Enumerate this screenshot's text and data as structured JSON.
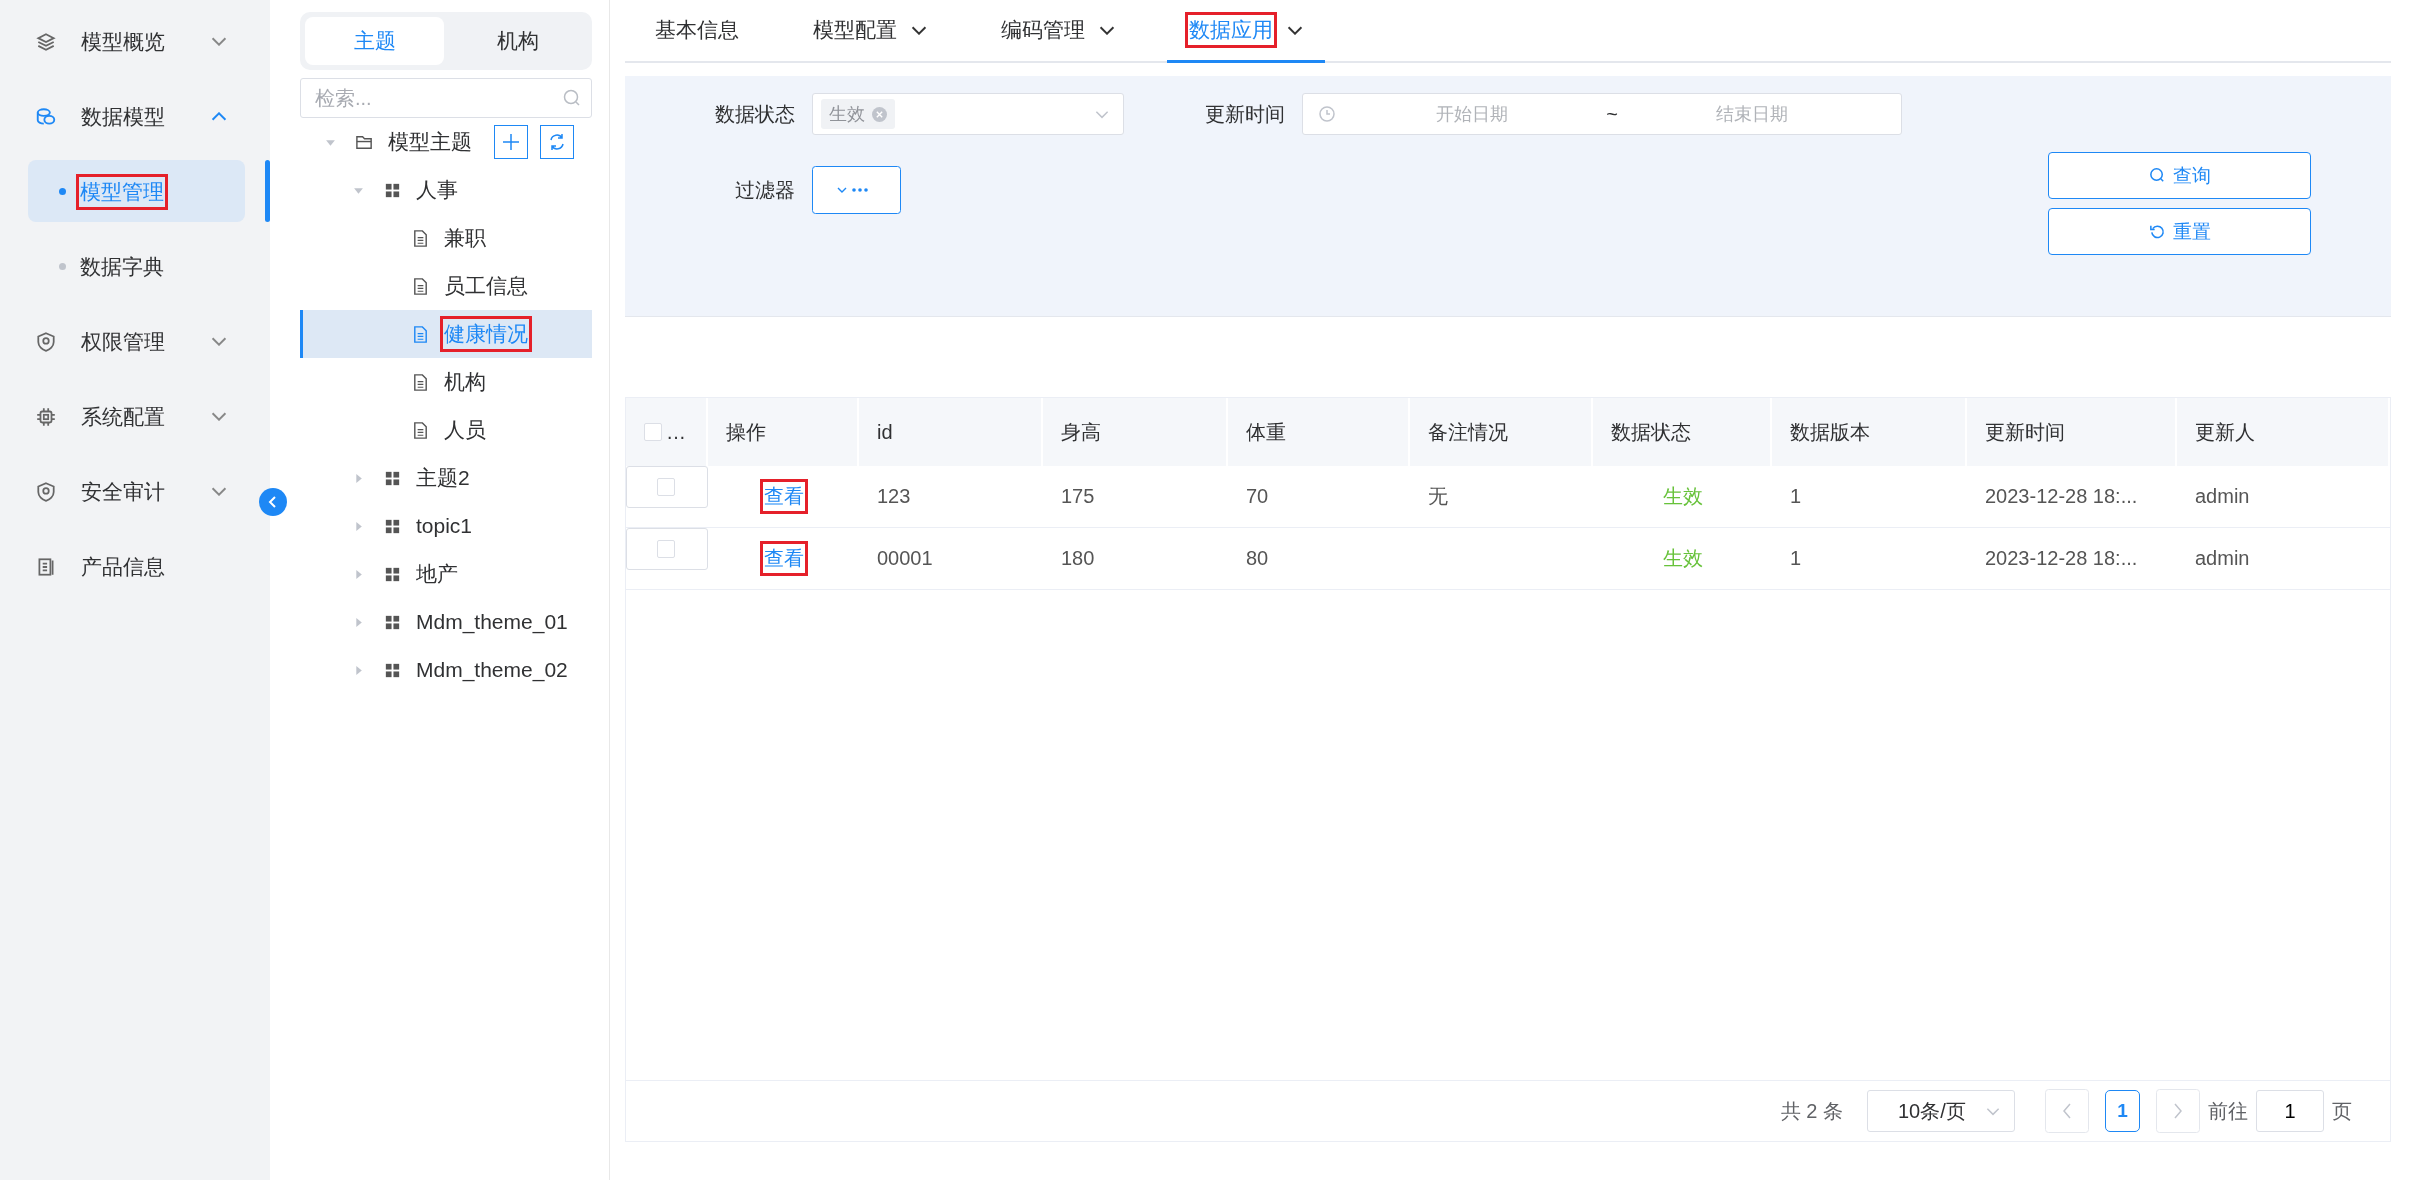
{
  "sidebar": {
    "items": [
      {
        "label": "模型概览",
        "kind": "group",
        "expanded": false
      },
      {
        "label": "数据模型",
        "kind": "group",
        "expanded": true,
        "children": [
          {
            "label": "模型管理",
            "selected": true,
            "highlighted": true
          },
          {
            "label": "数据字典",
            "selected": false,
            "highlighted": false
          }
        ]
      },
      {
        "label": "权限管理",
        "kind": "group",
        "expanded": false
      },
      {
        "label": "系统配置",
        "kind": "group",
        "expanded": false
      },
      {
        "label": "安全审计",
        "kind": "group",
        "expanded": false
      },
      {
        "label": "产品信息",
        "kind": "link"
      }
    ]
  },
  "tree_panel": {
    "tabs": [
      {
        "label": "主题",
        "selected": true
      },
      {
        "label": "机构",
        "selected": false
      }
    ],
    "search": {
      "placeholder": "检索..."
    },
    "nodes": [
      {
        "label": "模型主题",
        "kind": "folder",
        "expanded": true,
        "selected": false,
        "highlighted": false,
        "children": [
          {
            "label": "人事",
            "kind": "group",
            "expanded": true,
            "selected": false,
            "highlighted": false,
            "children": [
              {
                "label": "兼职",
                "kind": "doc",
                "selected": false,
                "highlighted": false
              },
              {
                "label": "员工信息",
                "kind": "doc",
                "selected": false,
                "highlighted": false
              },
              {
                "label": "健康情况",
                "kind": "doc",
                "selected": true,
                "highlighted": true
              },
              {
                "label": "机构",
                "kind": "doc",
                "selected": false,
                "highlighted": false
              },
              {
                "label": "人员",
                "kind": "doc",
                "selected": false,
                "highlighted": false
              }
            ]
          },
          {
            "label": "主题2",
            "kind": "group",
            "expanded": false,
            "selected": false,
            "highlighted": false
          },
          {
            "label": "topic1",
            "kind": "group",
            "expanded": false,
            "selected": false,
            "highlighted": false
          },
          {
            "label": "地产",
            "kind": "group",
            "expanded": false,
            "selected": false,
            "highlighted": false
          },
          {
            "label": "Mdm_theme_01",
            "kind": "group",
            "expanded": false,
            "selected": false,
            "highlighted": false
          },
          {
            "label": "Mdm_theme_02",
            "kind": "group",
            "expanded": false,
            "selected": false,
            "highlighted": false
          }
        ]
      }
    ]
  },
  "tabs": [
    {
      "label": "基本信息",
      "dropdown": false,
      "selected": false,
      "highlighted": false
    },
    {
      "label": "模型配置",
      "dropdown": true,
      "selected": false,
      "highlighted": false
    },
    {
      "label": "编码管理",
      "dropdown": true,
      "selected": false,
      "highlighted": false
    },
    {
      "label": "数据应用",
      "dropdown": true,
      "selected": true,
      "highlighted": true
    }
  ],
  "filters": {
    "status_label": "数据状态",
    "status_tags": [
      "生效"
    ],
    "time_label": "更新时间",
    "start_placeholder": "开始日期",
    "range_separator": "~",
    "end_placeholder": "结束日期",
    "filter_label": "过滤器",
    "query_button": "查询",
    "reset_button": "重置"
  },
  "table": {
    "header_checked": false,
    "columns": [
      {
        "label": "…",
        "kind": "select"
      },
      {
        "label": "操作",
        "kind": "action"
      },
      {
        "label": "id",
        "kind": "text"
      },
      {
        "label": "身高",
        "kind": "text"
      },
      {
        "label": "体重",
        "kind": "text"
      },
      {
        "label": "备注情况",
        "kind": "text"
      },
      {
        "label": "数据状态",
        "kind": "status"
      },
      {
        "label": "数据版本",
        "kind": "text"
      },
      {
        "label": "更新时间",
        "kind": "text"
      },
      {
        "label": "更新人",
        "kind": "text"
      }
    ],
    "rows": [
      {
        "checked": false,
        "action_highlighted": true,
        "cells": [
          "",
          "查看",
          "123",
          "175",
          "70",
          "无",
          "生效",
          "1",
          "2023-12-28 18:...",
          "admin"
        ]
      },
      {
        "checked": false,
        "action_highlighted": true,
        "cells": [
          "",
          "查看",
          "00001",
          "180",
          "80",
          "",
          "生效",
          "1",
          "2023-12-28 18:...",
          "admin"
        ]
      }
    ]
  },
  "pagination": {
    "total": "共 2 条",
    "page_size": "10条/页",
    "pages": [
      {
        "label": "1",
        "selected": true
      }
    ],
    "goto_label": "前往",
    "goto_value": "1",
    "page_unit": "页"
  }
}
